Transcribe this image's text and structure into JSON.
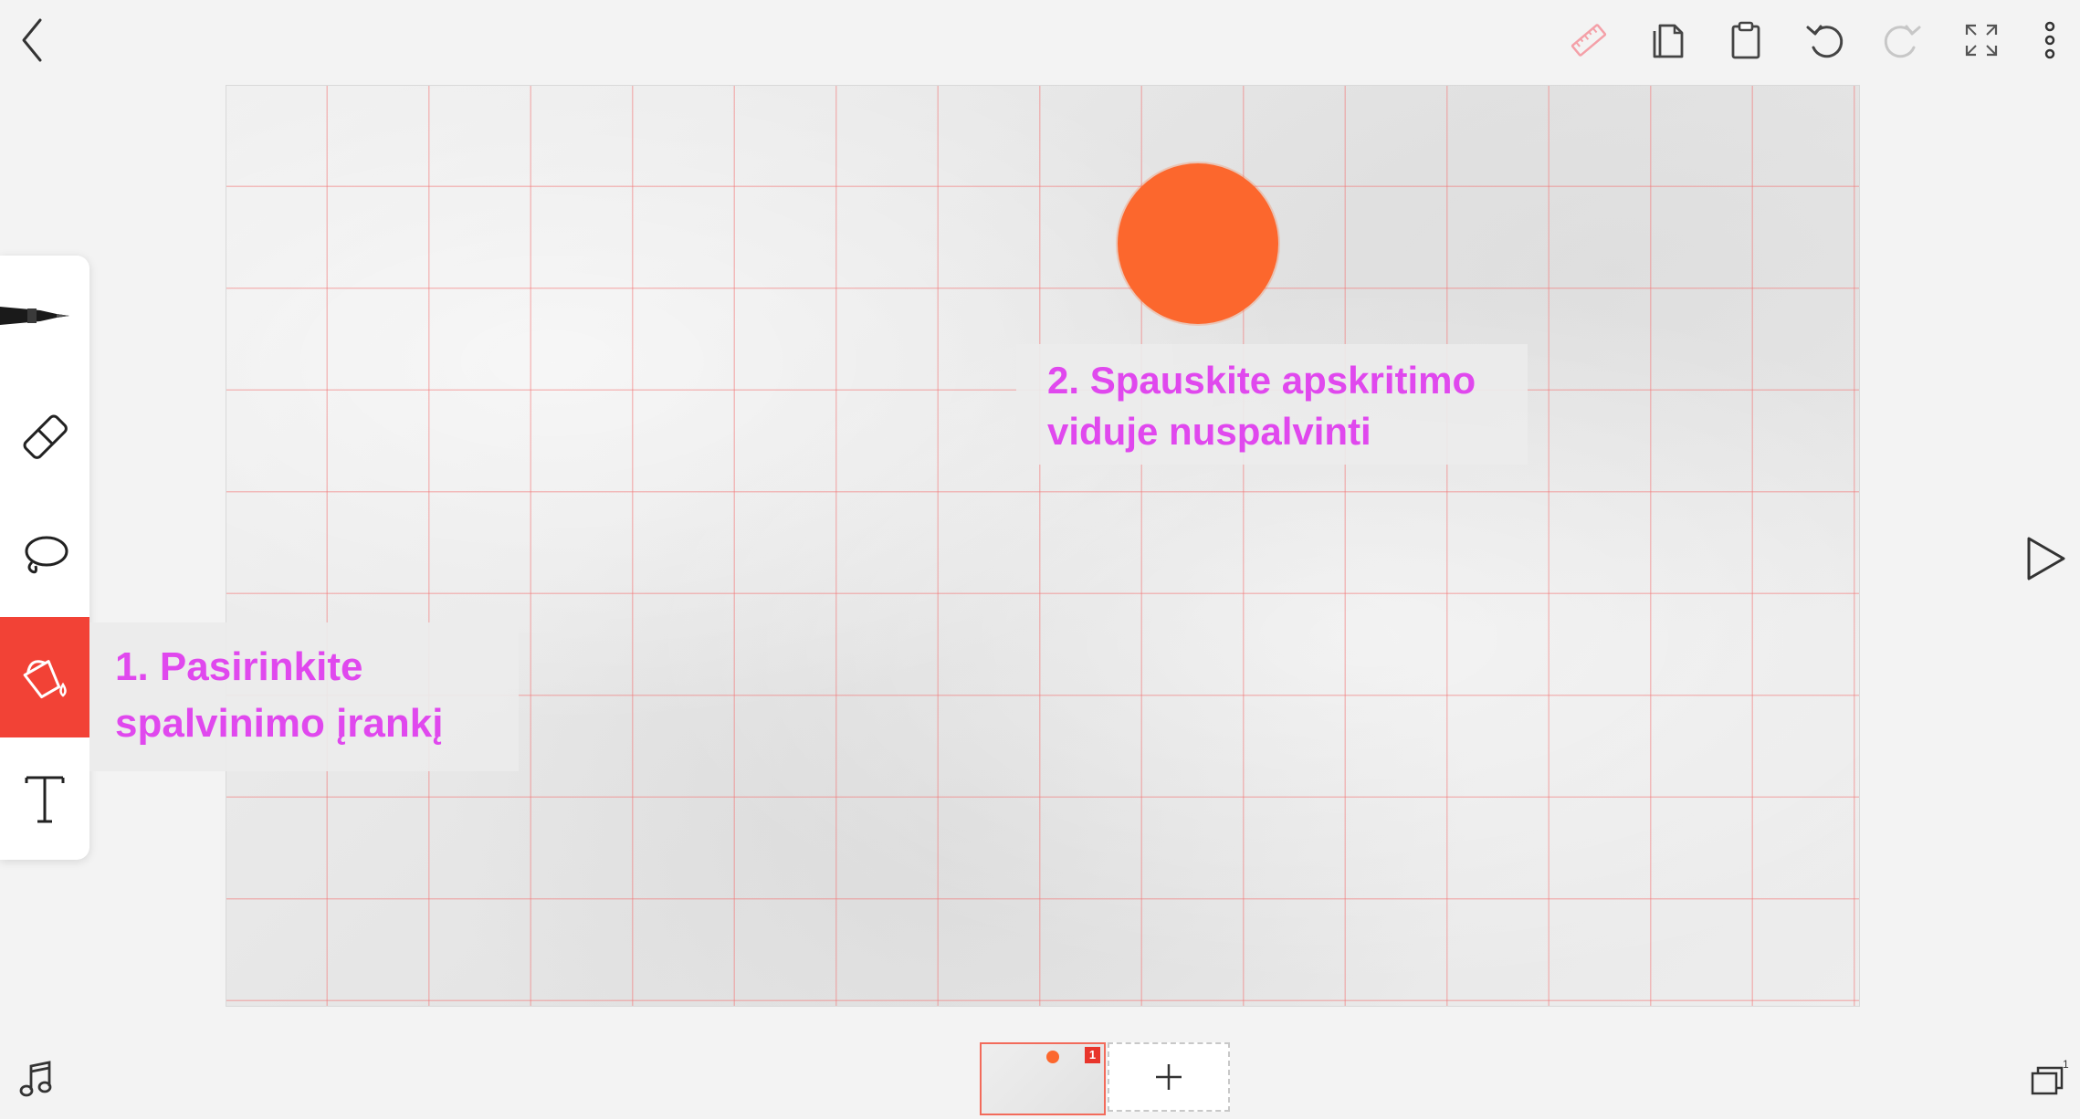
{
  "toolbar": {
    "back": "back-chevron-icon",
    "actions": [
      "ruler-icon",
      "copy-icon",
      "paste-icon",
      "undo-icon",
      "redo-icon",
      "fullscreen-icon",
      "more-icon"
    ]
  },
  "tools": [
    "pen",
    "eraser",
    "lasso",
    "fill-bucket",
    "text"
  ],
  "active_tool": "fill-bucket",
  "canvas": {
    "instruction_1": {
      "line1": "1. Pasirinkite",
      "line2": "spalvinimo įrankį"
    },
    "instruction_2": {
      "line1": "2. Spauskite apskritimo",
      "line2": "viduje nuspalvinti"
    },
    "circle_color": "#fc672d"
  },
  "frames": [
    {
      "number": "1"
    }
  ],
  "colors": {
    "accent": "#f24236",
    "annotation": "#e048ee",
    "grid": "#f27878"
  }
}
